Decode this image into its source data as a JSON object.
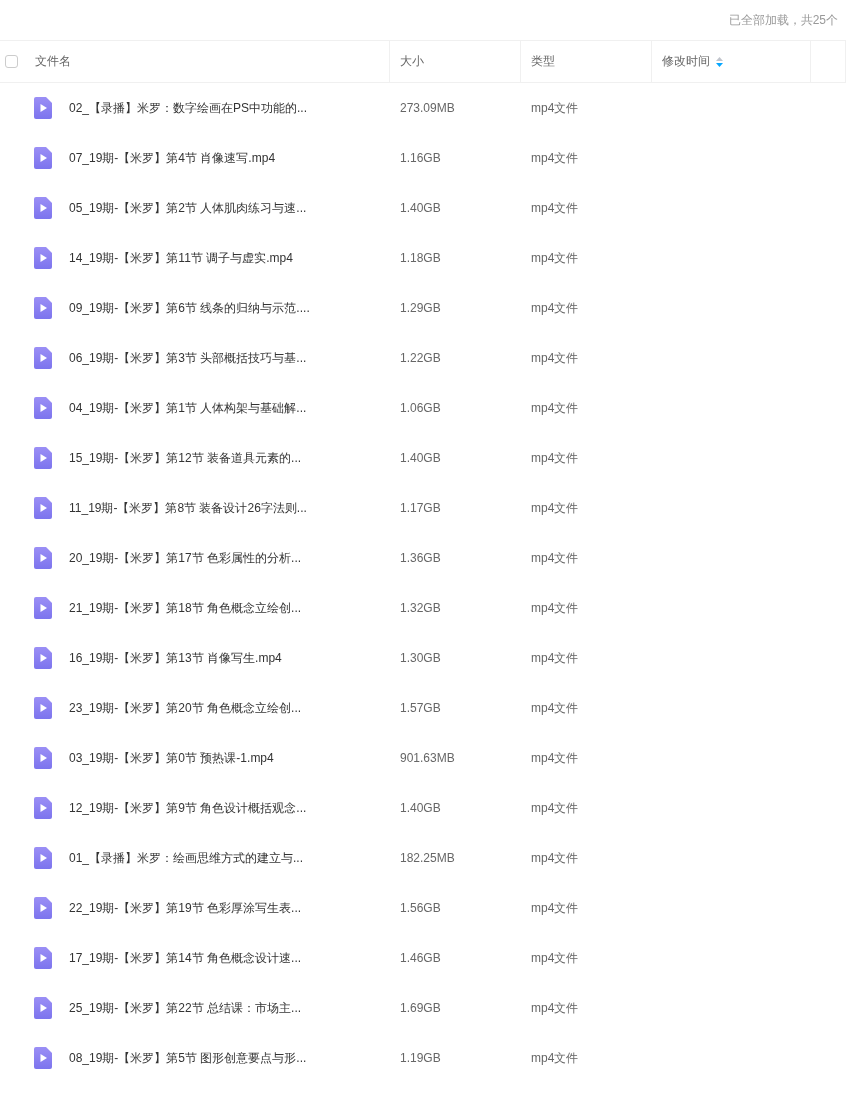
{
  "status": "已全部加载，共25个",
  "table": {
    "select_all": {
      "checked": false
    },
    "columns": [
      {
        "label": "文件名",
        "sorted": false
      },
      {
        "label": "大小",
        "sorted": false
      },
      {
        "label": "类型",
        "sorted": false
      },
      {
        "label": "修改时间",
        "sorted": true
      }
    ],
    "rows": [
      {
        "name": "02_【录播】米罗：数字绘画在PS中功能的...",
        "size": "273.09MB",
        "type": "mp4文件"
      },
      {
        "name": "07_19期-【米罗】第4节 肖像速写.mp4",
        "size": "1.16GB",
        "type": "mp4文件"
      },
      {
        "name": "05_19期-【米罗】第2节 人体肌肉练习与速...",
        "size": "1.40GB",
        "type": "mp4文件"
      },
      {
        "name": "14_19期-【米罗】第11节 调子与虚实.mp4",
        "size": "1.18GB",
        "type": "mp4文件"
      },
      {
        "name": "09_19期-【米罗】第6节 线条的归纳与示范....",
        "size": "1.29GB",
        "type": "mp4文件"
      },
      {
        "name": "06_19期-【米罗】第3节 头部概括技巧与基...",
        "size": "1.22GB",
        "type": "mp4文件"
      },
      {
        "name": "04_19期-【米罗】第1节 人体构架与基础解...",
        "size": "1.06GB",
        "type": "mp4文件"
      },
      {
        "name": "15_19期-【米罗】第12节 装备道具元素的...",
        "size": "1.40GB",
        "type": "mp4文件"
      },
      {
        "name": "11_19期-【米罗】第8节 装备设计26字法则...",
        "size": "1.17GB",
        "type": "mp4文件"
      },
      {
        "name": "20_19期-【米罗】第17节 色彩属性的分析...",
        "size": "1.36GB",
        "type": "mp4文件"
      },
      {
        "name": "21_19期-【米罗】第18节 角色概念立绘创...",
        "size": "1.32GB",
        "type": "mp4文件"
      },
      {
        "name": "16_19期-【米罗】第13节 肖像写生.mp4",
        "size": "1.30GB",
        "type": "mp4文件"
      },
      {
        "name": "23_19期-【米罗】第20节 角色概念立绘创...",
        "size": "1.57GB",
        "type": "mp4文件"
      },
      {
        "name": "03_19期-【米罗】第0节 预热课-1.mp4",
        "size": "901.63MB",
        "type": "mp4文件"
      },
      {
        "name": "12_19期-【米罗】第9节 角色设计概括观念...",
        "size": "1.40GB",
        "type": "mp4文件"
      },
      {
        "name": "01_【录播】米罗：绘画思维方式的建立与...",
        "size": "182.25MB",
        "type": "mp4文件"
      },
      {
        "name": "22_19期-【米罗】第19节 色彩厚涂写生表...",
        "size": "1.56GB",
        "type": "mp4文件"
      },
      {
        "name": "17_19期-【米罗】第14节 角色概念设计速...",
        "size": "1.46GB",
        "type": "mp4文件"
      },
      {
        "name": "25_19期-【米罗】第22节 总结课：市场主...",
        "size": "1.69GB",
        "type": "mp4文件"
      },
      {
        "name": "08_19期-【米罗】第5节 图形创意要点与形...",
        "size": "1.19GB",
        "type": "mp4文件"
      }
    ]
  }
}
